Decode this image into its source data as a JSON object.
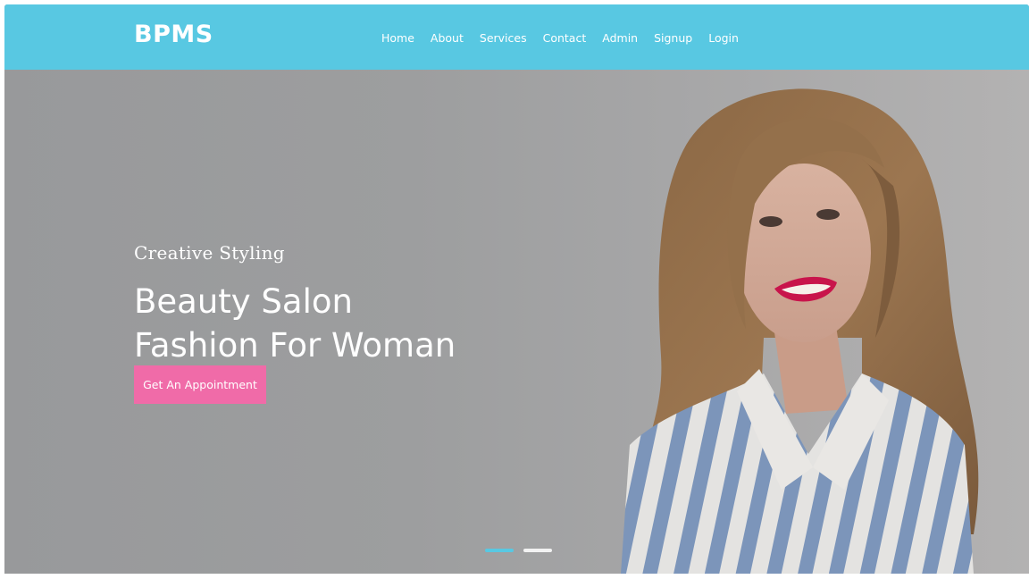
{
  "brand": {
    "name": "BPMS"
  },
  "nav": {
    "items": [
      {
        "label": "Home"
      },
      {
        "label": "About"
      },
      {
        "label": "Services"
      },
      {
        "label": "Contact"
      },
      {
        "label": "Admin"
      },
      {
        "label": "Signup"
      },
      {
        "label": "Login"
      }
    ]
  },
  "hero": {
    "tagline": "Creative Styling",
    "headline_line1": "Beauty Salon",
    "headline_line2": "Fashion For Woman",
    "cta_label": "Get An Appointment",
    "slide_count": 2,
    "active_slide": 1
  },
  "colors": {
    "header": "#58c8e2",
    "cta": "#f06ba8",
    "active_dot": "#58c8e2"
  }
}
